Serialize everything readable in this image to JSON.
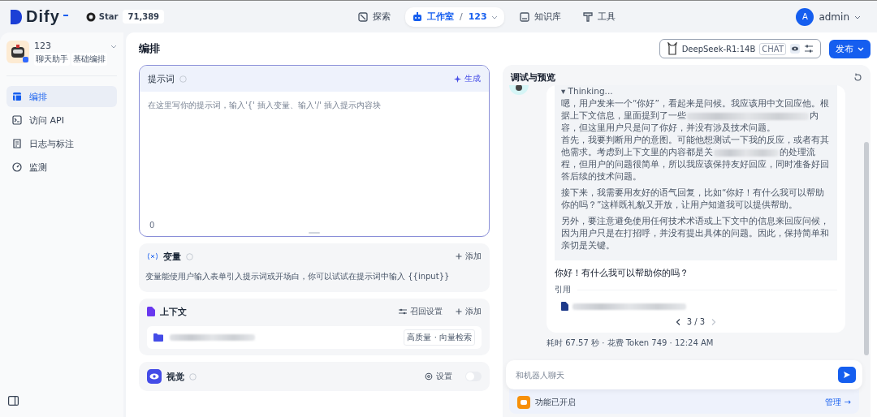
{
  "brand": {
    "name": "Dify"
  },
  "github": {
    "label": "Star",
    "count": "71,389"
  },
  "nav": [
    {
      "label": "探索",
      "selected": false
    },
    {
      "label": "工作室",
      "selected": true,
      "crumb_separator": "/",
      "crumb": "123"
    },
    {
      "label": "知识库",
      "selected": false
    },
    {
      "label": "工具",
      "selected": false
    }
  ],
  "user": {
    "initial": "A",
    "name": "admin"
  },
  "app": {
    "name": "123",
    "tags": [
      "聊天助手",
      "基础编排"
    ]
  },
  "sidebar": {
    "items": [
      {
        "label": "编排",
        "selected": true
      },
      {
        "label": "访问 API",
        "selected": false
      },
      {
        "label": "日志与标注",
        "selected": false
      },
      {
        "label": "监测",
        "selected": false
      }
    ]
  },
  "page_title": "编排",
  "model": {
    "name": "DeepSeek-R1:14B",
    "mode": "CHAT"
  },
  "publish": "发布",
  "prompt": {
    "title": "提示词",
    "generate": "生成",
    "placeholder": "在这里写你的提示词，输入'{' 插入变量、输入'/' 插入提示内容块",
    "count": "0"
  },
  "variables": {
    "title": "变量",
    "add": "添加",
    "hint": "变量能使用户输入表单引入提示词或开场白，你可以试试在提示词中输入 {{input}}"
  },
  "context": {
    "title": "上下文",
    "settings": "召回设置",
    "add": "添加",
    "dataset": {
      "tag": "高质量 · 向量检索"
    }
  },
  "vision": {
    "title": "视觉",
    "settings": "设置",
    "enabled": false
  },
  "debug": {
    "title": "调试与预览",
    "thinking": {
      "label": "▾ Thinking...",
      "paragraphs": [
        [
          {
            "kind": "text",
            "text": "嗯，用户发来一个“你好”，看起来是问候。我应该用中文回应他。根据上下文信息，里面提到了一些"
          },
          {
            "kind": "redacted"
          },
          {
            "kind": "text",
            "text": "内容，但这里用户只是问了你好，并没有涉及技术问题。"
          }
        ],
        [
          {
            "kind": "text",
            "text": "首先，我要判断用户的意图。可能他想测试一下我的反应，或者有其他需求。考虑到上下文里的内容都是关"
          },
          {
            "kind": "redacted"
          },
          {
            "kind": "text",
            "text": "的处理流程，但用户的问题很简单，所以我应该保持友好回应，同时准备好回答后续的技术问题。"
          }
        ],
        [
          {
            "kind": "text",
            "text": "接下来，我需要用友好的语气回复，比如“你好！有什么我可以帮助你的吗？”这样既礼貌又开放，让用户知道我可以提供帮助。"
          }
        ],
        [
          {
            "kind": "text",
            "text": "另外，要注意避免使用任何技术术语或上下文中的信息来回应问候，因为用户只是在打招呼，并没有提出具体的问题。因此，保持简单和亲切是关键。"
          }
        ]
      ]
    },
    "answer": "你好！有什么我可以帮助你的吗？",
    "citation_label": "引用",
    "pager": "3 / 3",
    "meta": "耗时 67.57 秒 · 花费 Token 749 · 12:24 AM",
    "input_placeholder": "和机器人聊天",
    "features": "功能已开启",
    "manage": "管理 →"
  }
}
